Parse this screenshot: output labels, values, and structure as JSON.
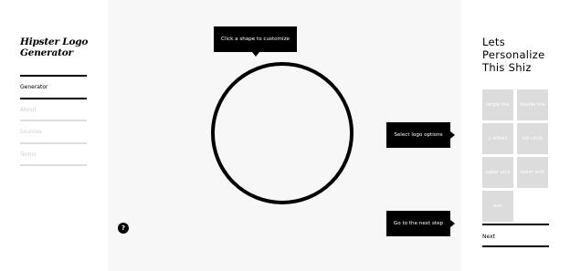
{
  "app": {
    "logo_text": "Hipster Logo Generator"
  },
  "sidebar": {
    "items": [
      {
        "label": "Generator",
        "active": true
      },
      {
        "label": "About",
        "active": false
      },
      {
        "label": "Sources",
        "active": false
      },
      {
        "label": "Terms",
        "active": false
      }
    ]
  },
  "stage": {
    "tip_shape": "Click a shape to customize",
    "tip_options": "Select logo options",
    "tip_next": "Go to the next step",
    "help_icon_glyph": "?"
  },
  "panel": {
    "heading_lines": [
      "Lets",
      "Personalize",
      "This Shiz"
    ],
    "options": [
      {
        "label": "single line"
      },
      {
        "label": "double line"
      },
      {
        "label": "x letters"
      },
      {
        "label": "full circle"
      },
      {
        "label": "upper arch"
      },
      {
        "label": "lower arch"
      },
      {
        "label": "text"
      }
    ],
    "next_label": "Next"
  },
  "colors": {
    "accent": "#000000",
    "stage_bg": "#f7f7f7",
    "option_bg": "#dcdcdc"
  }
}
